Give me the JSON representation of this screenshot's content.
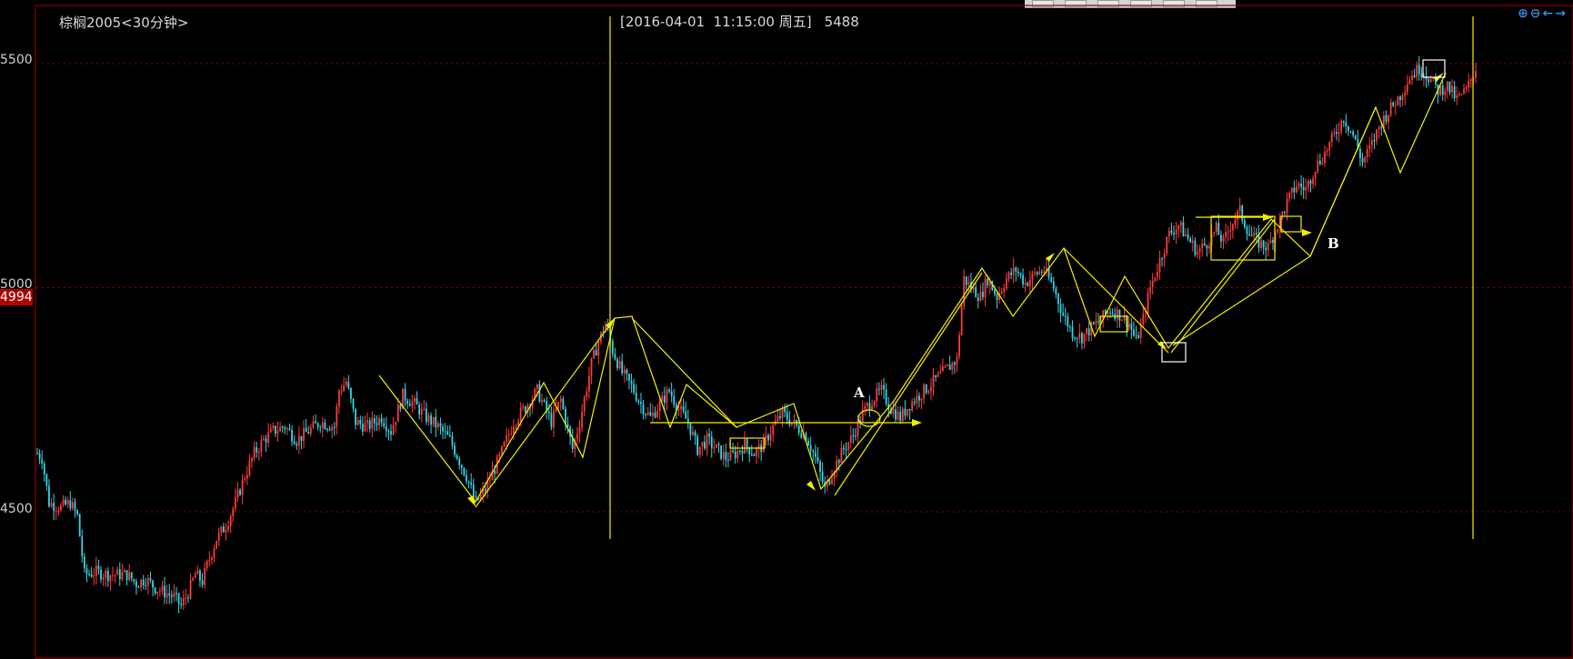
{
  "header": {
    "instrument_title": "棕榈2005<30分钟>",
    "cursor_datetime": "[2016-04-01  11:15:00 周五]",
    "cursor_price": "5488"
  },
  "last_price_badge": "4994",
  "toolbar_icons": [
    "zoom-in-icon",
    "zoom-out-icon",
    "arrow-left-icon",
    "arrow-right-icon"
  ],
  "chart_data": {
    "type": "candlestick",
    "y_tick_labels": [
      "5500",
      "5000",
      "4500"
    ],
    "y_ticks": [
      5500,
      5000,
      4500
    ],
    "ylim": [
      4280,
      5620
    ],
    "grid": true,
    "colors": {
      "up": "#ff3b3b",
      "down": "#35d6e8",
      "annotation": "#f5f000",
      "box": "#ffffff",
      "axis": "#8b0000"
    },
    "annotations": [
      "A",
      "B"
    ],
    "price_path": [
      [
        0,
        4630
      ],
      [
        2,
        4620
      ],
      [
        5,
        4520
      ],
      [
        10,
        4510
      ],
      [
        14,
        4520
      ],
      [
        17,
        4490
      ],
      [
        20,
        4360
      ],
      [
        25,
        4365
      ],
      [
        30,
        4360
      ],
      [
        38,
        4360
      ],
      [
        42,
        4340
      ],
      [
        46,
        4350
      ],
      [
        50,
        4330
      ],
      [
        54,
        4320
      ],
      [
        58,
        4310
      ],
      [
        61,
        4290
      ],
      [
        64,
        4320
      ],
      [
        67,
        4360
      ],
      [
        70,
        4345
      ],
      [
        72,
        4380
      ],
      [
        76,
        4440
      ],
      [
        80,
        4470
      ],
      [
        84,
        4520
      ],
      [
        88,
        4580
      ],
      [
        92,
        4630
      ],
      [
        96,
        4660
      ],
      [
        100,
        4680
      ],
      [
        105,
        4690
      ],
      [
        110,
        4660
      ],
      [
        115,
        4680
      ],
      [
        120,
        4700
      ],
      [
        126,
        4690
      ],
      [
        128,
        4770
      ],
      [
        131,
        4790
      ],
      [
        135,
        4700
      ],
      [
        140,
        4690
      ],
      [
        146,
        4710
      ],
      [
        150,
        4680
      ],
      [
        155,
        4760
      ],
      [
        160,
        4740
      ],
      [
        165,
        4710
      ],
      [
        170,
        4690
      ],
      [
        175,
        4660
      ],
      [
        182,
        4580
      ],
      [
        186,
        4520
      ],
      [
        190,
        4550
      ],
      [
        196,
        4620
      ],
      [
        202,
        4700
      ],
      [
        208,
        4740
      ],
      [
        212,
        4770
      ],
      [
        218,
        4700
      ],
      [
        222,
        4750
      ],
      [
        227,
        4640
      ],
      [
        230,
        4700
      ],
      [
        235,
        4830
      ],
      [
        238,
        4880
      ],
      [
        241,
        4920
      ],
      [
        244,
        4860
      ],
      [
        248,
        4810
      ],
      [
        252,
        4780
      ],
      [
        256,
        4740
      ],
      [
        260,
        4710
      ],
      [
        264,
        4740
      ],
      [
        268,
        4770
      ],
      [
        272,
        4730
      ],
      [
        276,
        4700
      ],
      [
        280,
        4640
      ],
      [
        284,
        4660
      ],
      [
        288,
        4640
      ],
      [
        292,
        4620
      ],
      [
        296,
        4630
      ],
      [
        300,
        4650
      ],
      [
        304,
        4630
      ],
      [
        308,
        4650
      ],
      [
        312,
        4690
      ],
      [
        316,
        4720
      ],
      [
        320,
        4700
      ],
      [
        326,
        4670
      ],
      [
        330,
        4620
      ],
      [
        334,
        4550
      ],
      [
        338,
        4600
      ],
      [
        342,
        4640
      ],
      [
        346,
        4670
      ],
      [
        350,
        4720
      ],
      [
        354,
        4750
      ],
      [
        358,
        4770
      ],
      [
        362,
        4730
      ],
      [
        366,
        4710
      ],
      [
        370,
        4740
      ],
      [
        374,
        4760
      ],
      [
        378,
        4780
      ],
      [
        382,
        4800
      ],
      [
        386,
        4820
      ],
      [
        390,
        4840
      ],
      [
        393,
        5020
      ],
      [
        396,
        5000
      ],
      [
        400,
        4980
      ],
      [
        403,
        5020
      ],
      [
        407,
        4980
      ],
      [
        411,
        5020
      ],
      [
        415,
        5040
      ],
      [
        419,
        5010
      ],
      [
        423,
        5030
      ],
      [
        427,
        5040
      ],
      [
        431,
        5000
      ],
      [
        435,
        4940
      ],
      [
        439,
        4900
      ],
      [
        443,
        4890
      ],
      [
        447,
        4910
      ],
      [
        451,
        4930
      ],
      [
        455,
        4950
      ],
      [
        459,
        4940
      ],
      [
        463,
        4920
      ],
      [
        466,
        4880
      ],
      [
        469,
        4930
      ],
      [
        472,
        5000
      ],
      [
        476,
        5060
      ],
      [
        480,
        5120
      ],
      [
        484,
        5140
      ],
      [
        488,
        5110
      ],
      [
        492,
        5080
      ],
      [
        496,
        5100
      ],
      [
        500,
        5130
      ],
      [
        503,
        5100
      ],
      [
        506,
        5140
      ],
      [
        510,
        5170
      ],
      [
        514,
        5120
      ],
      [
        518,
        5100
      ],
      [
        522,
        5090
      ],
      [
        526,
        5140
      ],
      [
        530,
        5190
      ],
      [
        534,
        5230
      ],
      [
        538,
        5220
      ],
      [
        542,
        5270
      ],
      [
        546,
        5300
      ],
      [
        550,
        5340
      ],
      [
        554,
        5380
      ],
      [
        558,
        5340
      ],
      [
        562,
        5280
      ],
      [
        566,
        5320
      ],
      [
        570,
        5370
      ],
      [
        574,
        5400
      ],
      [
        578,
        5430
      ],
      [
        582,
        5470
      ],
      [
        586,
        5490
      ],
      [
        590,
        5470
      ],
      [
        594,
        5440
      ],
      [
        598,
        5450
      ],
      [
        602,
        5420
      ],
      [
        606,
        5440
      ],
      [
        610,
        5490
      ]
    ]
  }
}
